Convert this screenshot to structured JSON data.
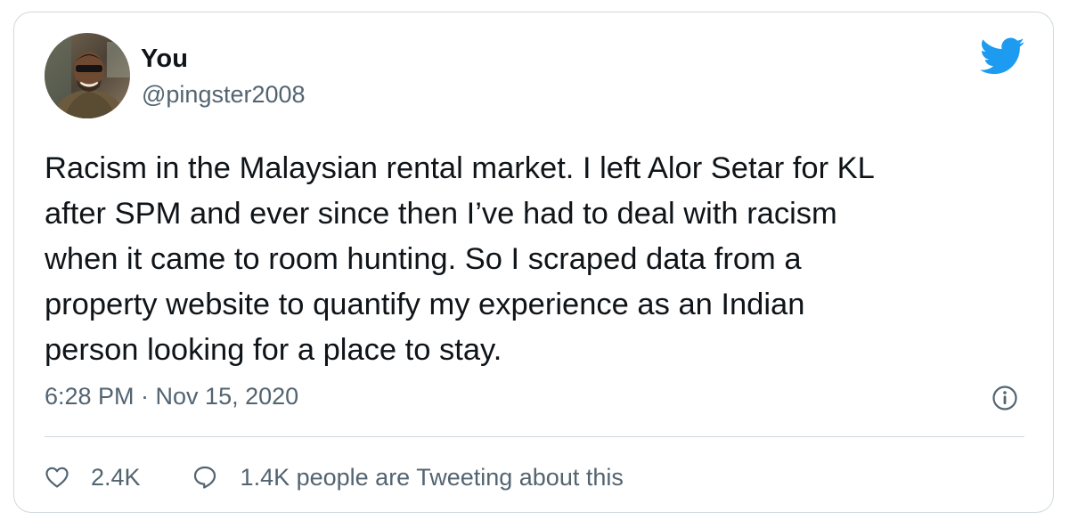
{
  "user": {
    "name": "You",
    "handle": "@pingster2008"
  },
  "tweet": {
    "text": "Racism in the Malaysian rental market. I left Alor Setar for KL\nafter SPM and ever since then I’ve had to deal with racism\nwhen it came to room hunting. So I scraped data from a\nproperty website to quantify my experience as an Indian\nperson looking for a place to stay.",
    "timestamp": "6:28 PM · Nov 15, 2020"
  },
  "actions": {
    "like_count": "2.4K",
    "reply_label": "1.4K people are Tweeting about this"
  },
  "icons": {
    "brand": "twitter-bird-icon",
    "info": "info-icon",
    "like": "heart-icon",
    "reply": "speech-bubble-icon"
  },
  "colors": {
    "brand": "#1d9bf0",
    "text": "#0f1419",
    "secondary": "#536471",
    "border": "#cfd9de"
  }
}
